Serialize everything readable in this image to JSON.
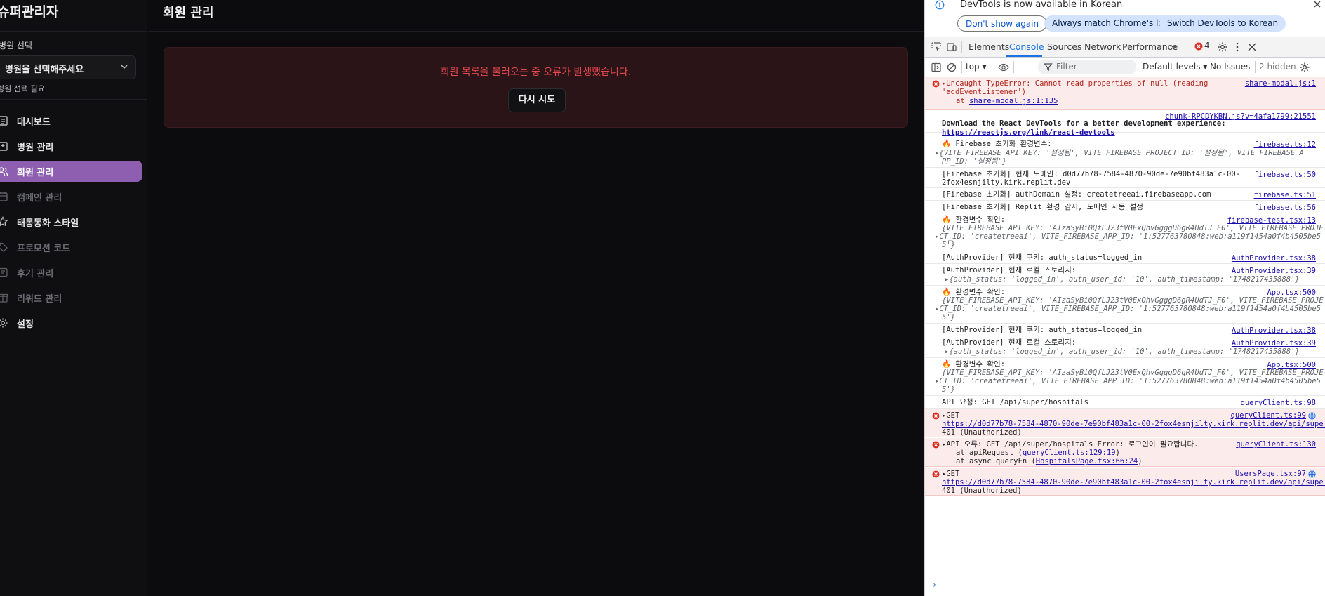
{
  "app": {
    "brand": "슈퍼관리자",
    "hospital_label": "병원 선택",
    "hospital_placeholder": "병원을 선택해주세요",
    "hospital_help": "병원 선택 필요",
    "nav": [
      {
        "label": "대시보드",
        "icon": "dashboard-icon",
        "state": "on"
      },
      {
        "label": "병원 관리",
        "icon": "hospital-icon",
        "state": "on"
      },
      {
        "label": "회원 관리",
        "icon": "users-icon",
        "state": "active"
      },
      {
        "label": "캠페인 관리",
        "icon": "calendar-icon",
        "state": "off"
      },
      {
        "label": "태몽동화 스타일",
        "icon": "star-icon",
        "state": "on"
      },
      {
        "label": "프로모션 코드",
        "icon": "tag-icon",
        "state": "off"
      },
      {
        "label": "후기 관리",
        "icon": "review-icon",
        "state": "off"
      },
      {
        "label": "리워드 관리",
        "icon": "gift-icon",
        "state": "off"
      },
      {
        "label": "설정",
        "icon": "gear-icon",
        "state": "on"
      }
    ],
    "page_title": "회원 관리",
    "error_message": "회원 목록을 불러오는 중 오류가 발생했습니다.",
    "retry_label": "다시 시도",
    "colors": {
      "accent": "#8e5fb0",
      "error_text": "#e5484d",
      "error_bg": "#2a1418"
    }
  },
  "devtools": {
    "notice": "DevTools is now available in Korean",
    "btn_dont_show": "Don't show again",
    "btn_match": "Always match Chrome's language",
    "btn_switch": "Switch DevTools to Korean",
    "tabs": [
      "Elements",
      "Console",
      "Sources",
      "Network",
      "Performance"
    ],
    "active_tab": "Console",
    "error_count": "4",
    "context": "top",
    "filter_placeholder": "Filter",
    "levels": "Default levels",
    "issues": "No Issues",
    "hidden": "2 hidden",
    "messages": {
      "m1_l1": "Uncaught TypeError: Cannot read properties of null (reading",
      "m1_l2": "'addEventListener')",
      "m1_l3a": "at ",
      "m1_l3b": "share-modal.js:1:135",
      "m1_src": "share-modal.js:1",
      "m2_src": "chunk-RPCDYKBN.js?v=4afa1799:21551",
      "m2_l1": "Download the React DevTools for a better development experience:",
      "m2_l2": "https://reactjs.org/link/react-devtools",
      "m3_l1": "Firebase 초기화 환경변수:",
      "m3_l2": "{VITE_FIREBASE_API_KEY: '설정됨', VITE_FIREBASE_PROJECT_ID: '설정됨', VITE_FIREBASE_A",
      "m3_l3": "PP_ID: '설정됨'}",
      "m3_src": "firebase.ts:12",
      "m4_l1": "[Firebase 초기화] 현재 도메인: d0d77b78-7584-4870-90de-7e90bf483a1c-00-",
      "m4_l2": "2fox4esnjilty.kirk.replit.dev",
      "m4_src": "firebase.ts:50",
      "m5_l1": "[Firebase 초기화] authDomain 설정: createtreeai.firebaseapp.com",
      "m5_src": "firebase.ts:51",
      "m6_l1": "[Firebase 초기화] Replit 환경 감지, 도메인 자동 설정",
      "m6_src": "firebase.ts:56",
      "m7_l1": "환경변수 확인:",
      "m7_l2": "{VITE_FIREBASE_API_KEY: 'AIzaSyBi0QfLJ23tV0ExQhvGgggD6gR4UdTJ_F0', VITE_FIREBASE_PROJE",
      "m7_l3": "CT_ID: 'createtreeai', VITE_FIREBASE_APP_ID: '1:527763780848:web:a119f1454a0f4b4505be5",
      "m7_l4": "5'}",
      "m7_src": "firebase-test.tsx:13",
      "m8_l1": "[AuthProvider] 현재 쿠키: auth_status=logged_in",
      "m8_src": "AuthProvider.tsx:38",
      "m9_l1": "[AuthProvider] 현재 로컬 스토리지:",
      "m9_l2": "{auth_status: 'logged_in', auth_user_id: '10', auth_timestamp: '1748217435888'}",
      "m9_src": "AuthProvider.tsx:39",
      "m10_l1": "환경변수 확인:",
      "m10_l2": "{VITE_FIREBASE_API_KEY: 'AIzaSyBi0QfLJ23tV0ExQhvGgggD6gR4UdTJ_F0', VITE_FIREBASE_PROJE",
      "m10_l3": "CT_ID: 'createtreeai', VITE_FIREBASE_APP_ID: '1:527763780848:web:a119f1454a0f4b4505be5",
      "m10_l4": "5'}",
      "m10_src": "App.tsx:500",
      "m11_l1": "[AuthProvider] 현재 쿠키: auth_status=logged_in",
      "m11_src": "AuthProvider.tsx:38",
      "m12_l1": "[AuthProvider] 현재 로컬 스토리지:",
      "m12_l2": "{auth_status: 'logged_in', auth_user_id: '10', auth_timestamp: '1748217435888'}",
      "m12_src": "AuthProvider.tsx:39",
      "m13_l1": "환경변수 확인:",
      "m13_l2": "{VITE_FIREBASE_API_KEY: 'AIzaSyBi0QfLJ23tV0ExQhvGgggD6gR4UdTJ_F0', VITE_FIREBASE_PROJE",
      "m13_l3": "CT_ID: 'createtreeai', VITE_FIREBASE_APP_ID: '1:527763780848:web:a119f1454a0f4b4505be5",
      "m13_l4": "5'}",
      "m13_src": "App.tsx:500",
      "m14_l1": "API 요청: GET /api/super/hospitals",
      "m14_src": "queryClient.ts:98",
      "m15_l1": "GET",
      "m15_l2": "https://d0d77b78-7584-4870-90de-7e90bf483a1c-00-2fox4esnjilty.kirk.replit.dev/api/supe...",
      "m15_l3": "401 (Unauthorized)",
      "m15_src": "queryClient.ts:99",
      "m16_l1": "API 오류: GET /api/super/hospitals Error: 로그인이 필요합니다.",
      "m16_l2a": "at apiRequest (",
      "m16_l2b": "queryClient.ts:129:19",
      "m16_l3a": "at async queryFn (",
      "m16_l3b": "HospitalsPage.tsx:66:24",
      "m16_src": "queryClient.ts:130",
      "m17_l1": "GET",
      "m17_l2": "https://d0d77b78-7584-4870-90de-7e90bf483a1c-00-2fox4esnjilty.kirk.replit.dev/api/supe...",
      "m17_l3": "401 (Unauthorized)",
      "m17_src": "UsersPage.tsx:97"
    }
  }
}
